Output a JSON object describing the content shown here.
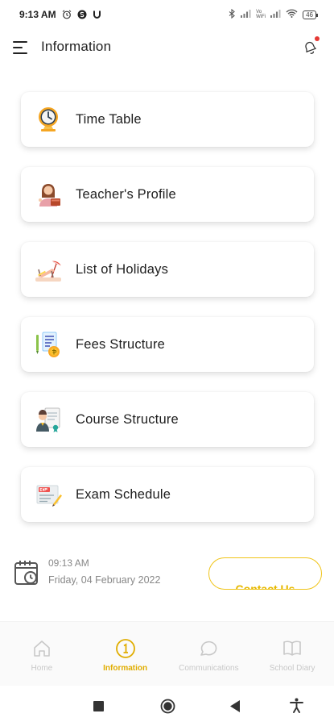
{
  "status_bar": {
    "time": "9:13 AM",
    "battery": "46",
    "net_label": "Vo\nWiFi"
  },
  "header": {
    "title": "Information"
  },
  "menu": [
    {
      "label": "Time Table",
      "icon": "clock-icon"
    },
    {
      "label": "Teacher's Profile",
      "icon": "teacher-icon"
    },
    {
      "label": "List of Holidays",
      "icon": "beach-icon"
    },
    {
      "label": "Fees Structure",
      "icon": "fees-icon"
    },
    {
      "label": "Course Structure",
      "icon": "course-icon"
    },
    {
      "label": "Exam Schedule",
      "icon": "exam-icon"
    }
  ],
  "footer": {
    "time": "09:13 AM",
    "date": "Friday, 04 February 2022",
    "contact_label": "Contact Us"
  },
  "bottom_nav": [
    {
      "label": "Home",
      "icon": "home-icon",
      "active": false
    },
    {
      "label": "Information",
      "icon": "info-icon",
      "active": true
    },
    {
      "label": "Communications",
      "icon": "chat-icon",
      "active": false
    },
    {
      "label": "School Diary",
      "icon": "book-icon",
      "active": false
    }
  ],
  "colors": {
    "accent": "#f0c419",
    "accent_text": "#e0ad00",
    "notification": "#e53935"
  }
}
